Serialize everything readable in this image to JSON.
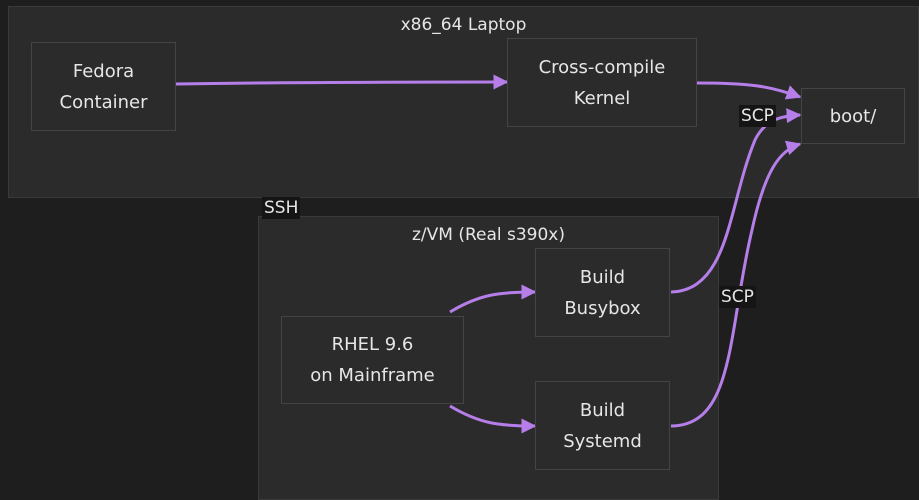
{
  "clusters": {
    "laptop": {
      "title": "x86_64 Laptop"
    },
    "zvm": {
      "title": "z/VM (Real s390x)"
    }
  },
  "nodes": {
    "fedora": {
      "line1": "Fedora",
      "line2": "Container"
    },
    "cross": {
      "line1": "Cross-compile",
      "line2": "Kernel"
    },
    "boot": {
      "label": "boot/"
    },
    "rhel": {
      "line1": "RHEL 9.6",
      "line2": "on Mainframe"
    },
    "busybox": {
      "line1": "Build",
      "line2": "Busybox"
    },
    "systemd": {
      "line1": "Build",
      "line2": "Systemd"
    }
  },
  "edge_labels": {
    "ssh": "SSH",
    "scp_top": "SCP",
    "scp_mid": "SCP"
  },
  "colors": {
    "edge": "#b57ee8",
    "background": "#1e1e1e",
    "cluster_fill": "#2b2b2b"
  }
}
